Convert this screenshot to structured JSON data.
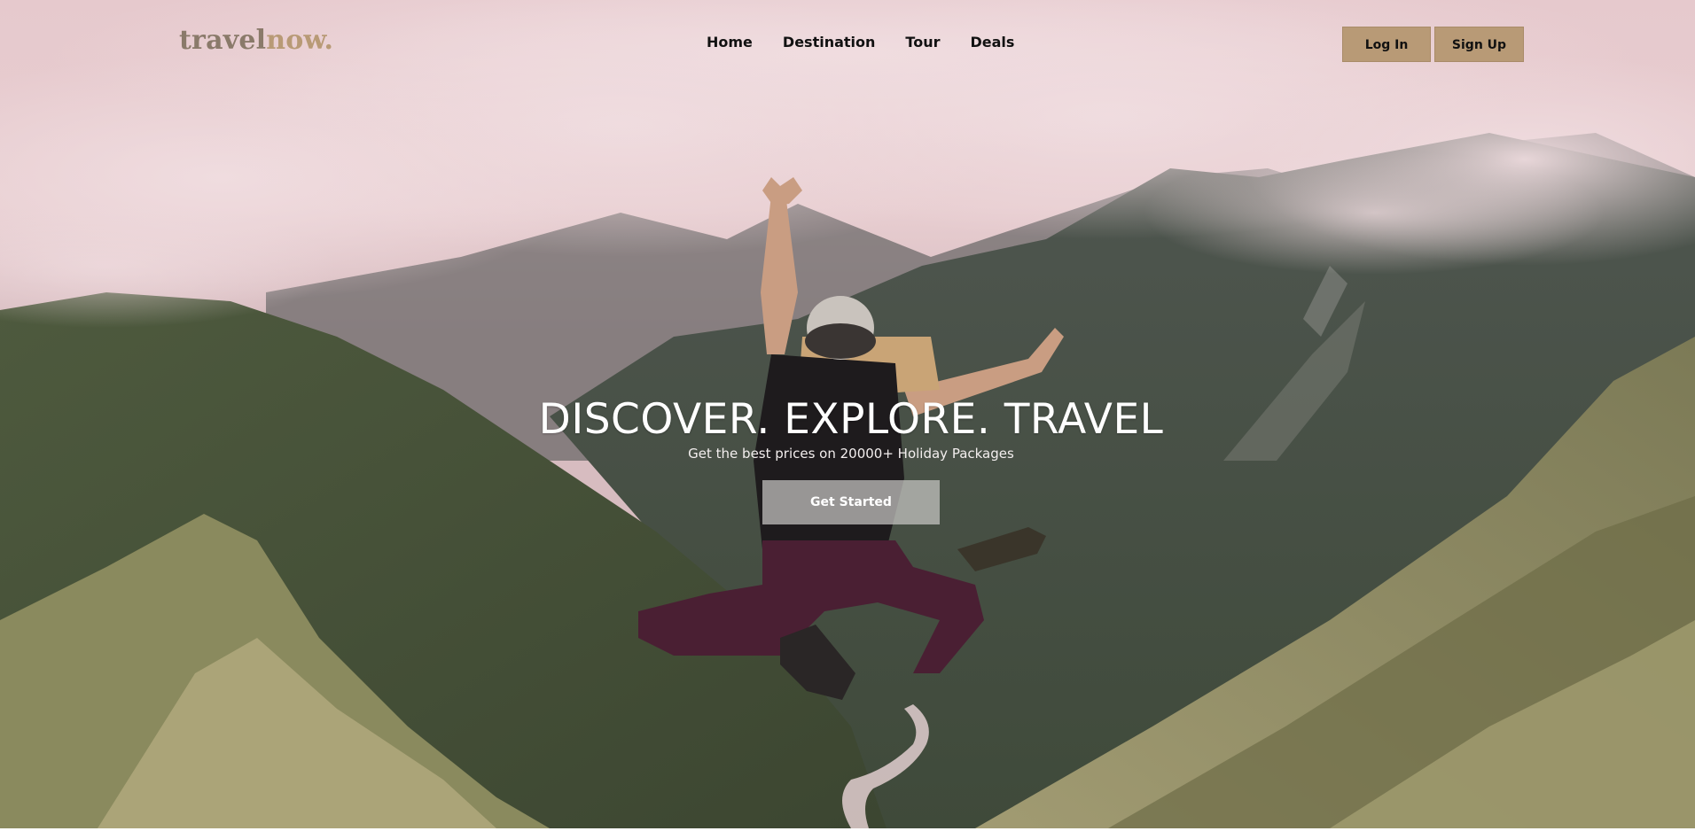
{
  "brand": {
    "logo_part_a": "travel",
    "logo_part_b": "now.",
    "accent_color": "#b89a76"
  },
  "nav": {
    "items": [
      {
        "label": "Home"
      },
      {
        "label": "Destination"
      },
      {
        "label": "Tour"
      },
      {
        "label": "Deals"
      }
    ]
  },
  "auth": {
    "login_label": "Log In",
    "signup_label": "Sign Up"
  },
  "hero": {
    "headline": "DISCOVER. EXPLORE. TRAVEL",
    "subline": "Get the best prices on 20000+ Holiday Packages",
    "cta_label": "Get Started",
    "background": "mountain-valley-jumping-traveler-photo"
  }
}
